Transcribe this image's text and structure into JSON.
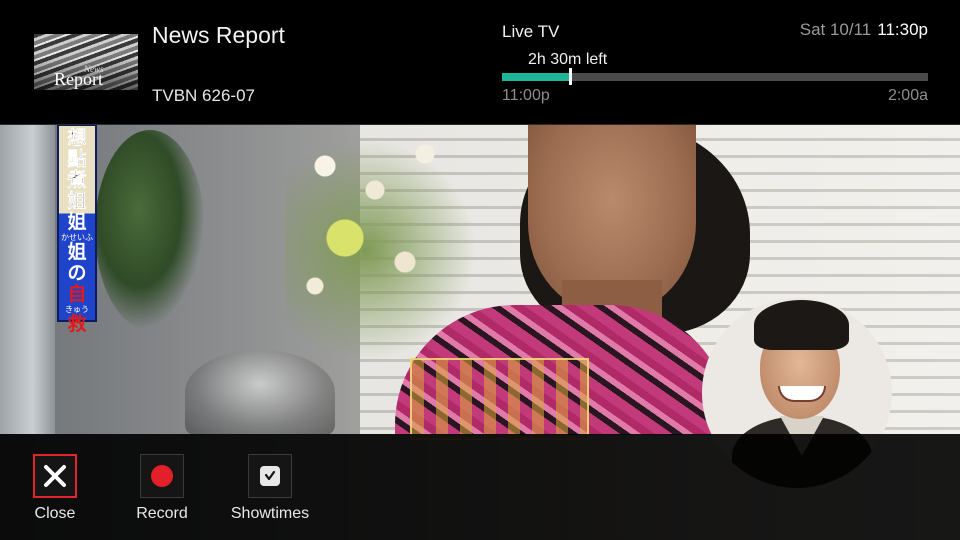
{
  "program": {
    "title": "News Report",
    "channel": "TVBN 626-07",
    "thumbnail": {
      "small_text": "News",
      "big_text": "Report"
    }
  },
  "live": {
    "label": "Live TV",
    "date": "Sat 10/11",
    "time": "11:30p",
    "time_left": "2h 30m left",
    "start_time": "11:00p",
    "end_time": "2:00a",
    "progress_fraction": 0.16
  },
  "video": {
    "caption_lines": [
      "想",
      "點",
      "煮",
      "姐",
      "姐",
      "姐",
      "の",
      "自",
      "救"
    ],
    "caption_ruby": [
      "かせいふ",
      "きゅう"
    ]
  },
  "actions": [
    {
      "label": "Close",
      "icon": "close-icon",
      "focused": true
    },
    {
      "label": "Record",
      "icon": "record-icon",
      "focused": false
    },
    {
      "label": "Showtimes",
      "icon": "clock-icon",
      "focused": false
    }
  ],
  "colors": {
    "accent_progress": "#1fb59a",
    "focus_border": "#e0262b",
    "record_red": "#e3202a"
  }
}
